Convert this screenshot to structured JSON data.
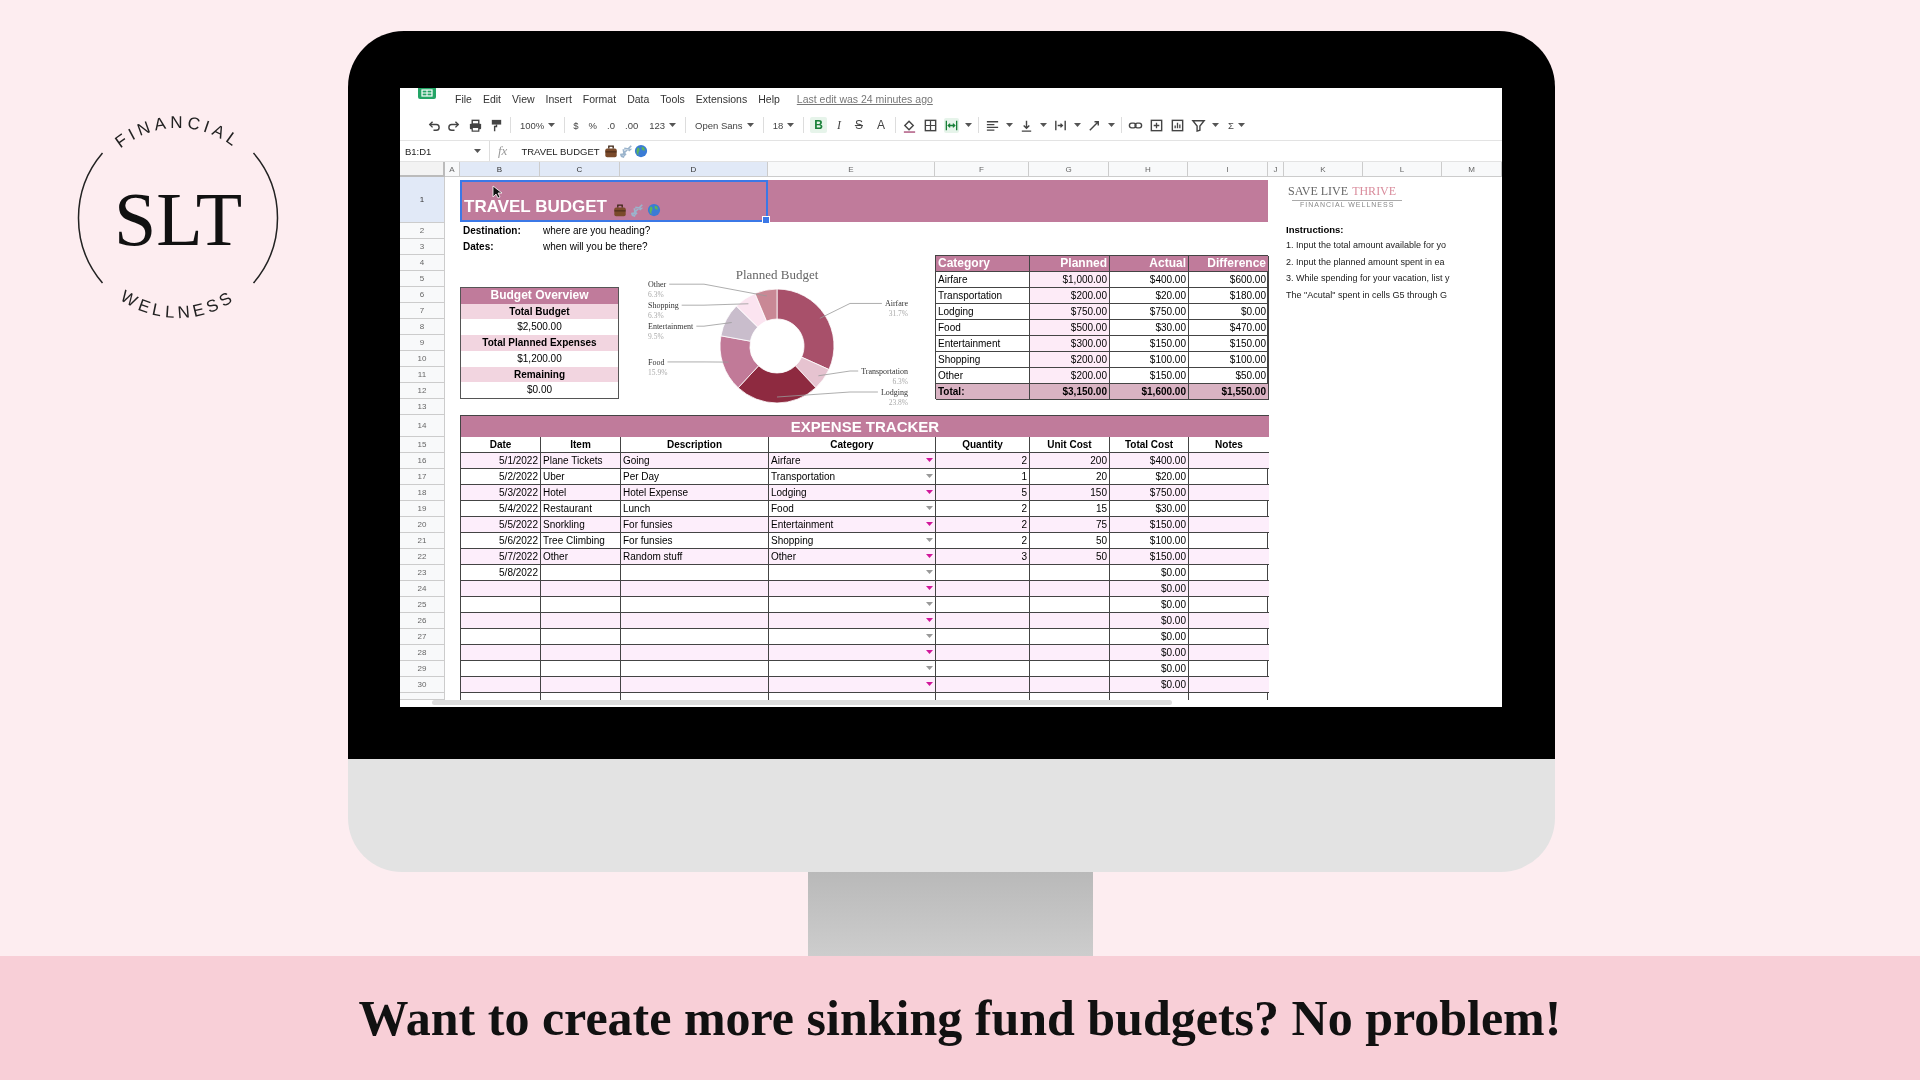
{
  "logo": {
    "top_text": "FINANCIAL",
    "monogram": "SLT",
    "bottom_text": "WELLNESS"
  },
  "menu_bar": {
    "items": [
      "File",
      "Edit",
      "View",
      "Insert",
      "Format",
      "Data",
      "Tools",
      "Extensions",
      "Help"
    ],
    "last_edit": "Last edit was 24 minutes ago"
  },
  "toolbar": {
    "zoom": "100%",
    "number_formats": [
      "$",
      "%",
      ".0",
      ".00",
      "123"
    ],
    "font": "Open Sans",
    "font_size": "18",
    "text_styles": [
      {
        "label": "B",
        "selected": true
      },
      {
        "label": "I",
        "selected": false
      },
      {
        "label": "S",
        "selected": false
      },
      {
        "label": "A",
        "selected": false
      }
    ],
    "merge_cells": {
      "selected": true
    },
    "function": "Σ"
  },
  "formula_bar": {
    "cell_range": "B1:D1",
    "fx": "fx",
    "content": "TRAVEL BUDGET"
  },
  "column_headers": [
    {
      "label": "A",
      "selected": false
    },
    {
      "label": "B",
      "selected": true
    },
    {
      "label": "C",
      "selected": true
    },
    {
      "label": "D",
      "selected": true
    },
    {
      "label": "E",
      "selected": false
    },
    {
      "label": "F",
      "selected": false
    },
    {
      "label": "G",
      "selected": false
    },
    {
      "label": "H",
      "selected": false
    },
    {
      "label": "I",
      "selected": false
    },
    {
      "label": "J",
      "selected": false
    },
    {
      "label": "K",
      "selected": false
    },
    {
      "label": "L",
      "selected": false
    },
    {
      "label": "M",
      "selected": false
    }
  ],
  "row_headers": [
    {
      "label": "1",
      "selected": true
    },
    {
      "label": "2",
      "selected": false
    },
    {
      "label": "3",
      "selected": false
    },
    {
      "label": "4",
      "selected": false
    },
    {
      "label": "5",
      "selected": false
    },
    {
      "label": "6",
      "selected": false
    },
    {
      "label": "7",
      "selected": false
    },
    {
      "label": "8",
      "selected": false
    },
    {
      "label": "9",
      "selected": false
    },
    {
      "label": "10",
      "selected": false
    },
    {
      "label": "11",
      "selected": false
    },
    {
      "label": "12",
      "selected": false
    },
    {
      "label": "13",
      "selected": false
    },
    {
      "label": "14",
      "selected": false
    },
    {
      "label": "15",
      "selected": false
    },
    {
      "label": "16",
      "selected": false
    },
    {
      "label": "17",
      "selected": false
    },
    {
      "label": "18",
      "selected": false
    },
    {
      "label": "19",
      "selected": false
    },
    {
      "label": "20",
      "selected": false
    },
    {
      "label": "21",
      "selected": false
    },
    {
      "label": "22",
      "selected": false
    },
    {
      "label": "23",
      "selected": false
    },
    {
      "label": "24",
      "selected": false
    },
    {
      "label": "25",
      "selected": false
    },
    {
      "label": "26",
      "selected": false
    },
    {
      "label": "27",
      "selected": false
    },
    {
      "label": "28",
      "selected": false
    },
    {
      "label": "29",
      "selected": false
    },
    {
      "label": "30",
      "selected": false
    }
  ],
  "sheet": {
    "title": "TRAVEL BUDGET",
    "trip_fields": [
      {
        "label": "Destination:",
        "value": "where are you heading?"
      },
      {
        "label": "Dates:",
        "value": "when will you be there?"
      }
    ],
    "budget_overview": {
      "title": "Budget Overview",
      "items": [
        {
          "label": "Total Budget",
          "value": "$2,500.00"
        },
        {
          "label": "Total Planned Expenses",
          "value": "$1,200.00"
        },
        {
          "label": "Remaining",
          "value": "$0.00"
        }
      ]
    },
    "chart_data": {
      "type": "donut",
      "title": "Planned Budget",
      "categories": [
        "Airfare",
        "Transportation",
        "Lodging",
        "Food",
        "Entertainment",
        "Shopping",
        "Other"
      ],
      "values": [
        31.7,
        6.3,
        23.8,
        15.9,
        9.5,
        6.3,
        6.3
      ],
      "value_labels": [
        "31.7%",
        "6.3%",
        "23.8%",
        "15.9%",
        "9.5%",
        "6.3%",
        "6.3%"
      ]
    },
    "category_table": {
      "columns": [
        "Category",
        "Planned",
        "Actual",
        "Difference"
      ],
      "rows": [
        [
          "Airfare",
          "$1,000.00",
          "$400.00",
          "$600.00"
        ],
        [
          "Transportation",
          "$200.00",
          "$20.00",
          "$180.00"
        ],
        [
          "Lodging",
          "$750.00",
          "$750.00",
          "$0.00"
        ],
        [
          "Food",
          "$500.00",
          "$30.00",
          "$470.00"
        ],
        [
          "Entertainment",
          "$300.00",
          "$150.00",
          "$150.00"
        ],
        [
          "Shopping",
          "$200.00",
          "$100.00",
          "$100.00"
        ],
        [
          "Other",
          "$200.00",
          "$150.00",
          "$50.00"
        ]
      ],
      "total": [
        "Total:",
        "$3,150.00",
        "$1,600.00",
        "$1,550.00"
      ]
    },
    "brand": {
      "name": "SAVE LIVE",
      "accent": "THRIVE",
      "tagline": "FINANCIAL WELLNESS"
    },
    "instructions": {
      "title": "Instructions:",
      "lines": [
        "1. Input the total amount available for yo",
        "2. Input the planned amount spent in ea",
        "3. While spending for your vacation, list y",
        "The \"Acutal\" spent in cells G5 through G"
      ]
    },
    "expense_tracker": {
      "title": "EXPENSE TRACKER",
      "columns": [
        "Date",
        "Item",
        "Description",
        "Category",
        "Quantity",
        "Unit Cost",
        "Total Cost",
        "Notes"
      ],
      "rows": [
        {
          "date": "5/1/2022",
          "item": "Plane Tickets",
          "description": "Going",
          "category": "Airfare",
          "quantity": "2",
          "unit_cost": "200",
          "total_cost": "$400.00"
        },
        {
          "date": "5/2/2022",
          "item": "Uber",
          "description": "Per Day",
          "category": "Transportation",
          "quantity": "1",
          "unit_cost": "20",
          "total_cost": "$20.00"
        },
        {
          "date": "5/3/2022",
          "item": "Hotel",
          "description": "Hotel Expense",
          "category": "Lodging",
          "quantity": "5",
          "unit_cost": "150",
          "total_cost": "$750.00"
        },
        {
          "date": "5/4/2022",
          "item": "Restaurant",
          "description": "Lunch",
          "category": "Food",
          "quantity": "2",
          "unit_cost": "15",
          "total_cost": "$30.00"
        },
        {
          "date": "5/5/2022",
          "item": "Snorkling",
          "description": "For funsies",
          "category": "Entertainment",
          "quantity": "2",
          "unit_cost": "75",
          "total_cost": "$150.00"
        },
        {
          "date": "5/6/2022",
          "item": "Tree Climbing",
          "description": "For funsies",
          "category": "Shopping",
          "quantity": "2",
          "unit_cost": "50",
          "total_cost": "$100.00"
        },
        {
          "date": "5/7/2022",
          "item": "Other",
          "description": "Random stuff",
          "category": "Other",
          "quantity": "3",
          "unit_cost": "50",
          "total_cost": "$150.00"
        },
        {
          "date": "5/8/2022",
          "total_cost": "$0.00"
        },
        {
          "total_cost": "$0.00"
        },
        {
          "total_cost": "$0.00"
        },
        {
          "total_cost": "$0.00"
        },
        {
          "total_cost": "$0.00"
        },
        {
          "total_cost": "$0.00"
        },
        {
          "total_cost": "$0.00"
        },
        {
          "total_cost": "$0.00"
        }
      ]
    }
  },
  "caption": "Want to create more sinking fund budgets? No problem!"
}
